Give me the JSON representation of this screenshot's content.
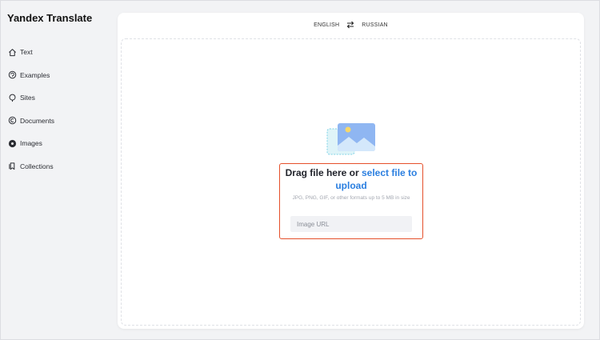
{
  "app": {
    "title": "Yandex Translate"
  },
  "sidebar": {
    "items": [
      {
        "label": "Text",
        "icon": "home-icon"
      },
      {
        "label": "Examples",
        "icon": "examples-icon"
      },
      {
        "label": "Sites",
        "icon": "sites-icon"
      },
      {
        "label": "Documents",
        "icon": "documents-icon"
      },
      {
        "label": "Images",
        "icon": "images-icon"
      },
      {
        "label": "Collections",
        "icon": "collections-icon"
      }
    ]
  },
  "langbar": {
    "source": "ENGLISH",
    "target": "RUSSIAN",
    "swap_icon": "swap-icon"
  },
  "upload": {
    "headline_prefix": "Drag file here or",
    "headline_link": "select file to upload",
    "hint": "JPG, PNG, GIF, or other formats up to 5 MB in size",
    "url_value": "",
    "url_placeholder": "Image URL",
    "illustration_icon": "image-upload-icon",
    "highlight_color": "#e5502b",
    "link_color": "#2b7fe0"
  }
}
